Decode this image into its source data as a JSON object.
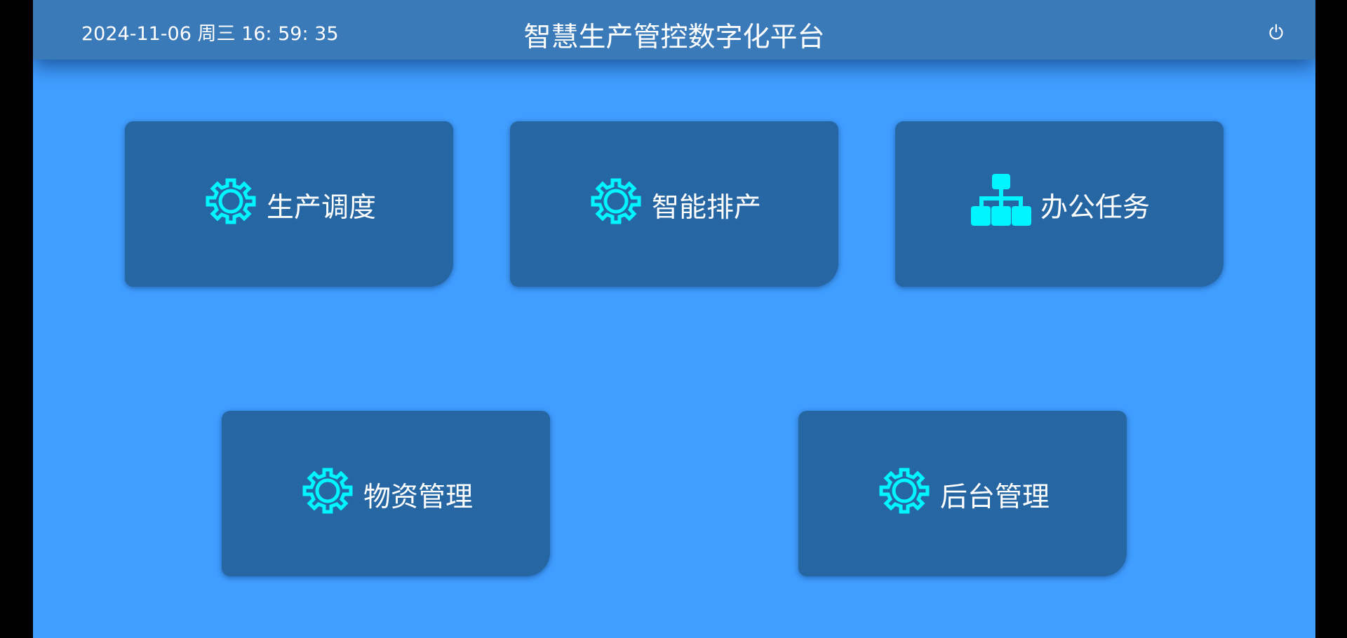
{
  "header": {
    "datetime": "2024-11-06 周三 16: 59: 35",
    "title": "智慧生产管控数字化平台",
    "power_icon": "power-icon"
  },
  "colors": {
    "background": "#409eff",
    "header": "#3a7ab9",
    "tile": "#2666a3",
    "icon_accent": "#00f5ff"
  },
  "tiles": [
    {
      "label": "生产调度",
      "icon": "gear-icon"
    },
    {
      "label": "智能排产",
      "icon": "gear-icon"
    },
    {
      "label": "办公任务",
      "icon": "org-chart-icon"
    },
    {
      "label": "物资管理",
      "icon": "gear-icon"
    },
    {
      "label": "后台管理",
      "icon": "gear-icon"
    }
  ]
}
